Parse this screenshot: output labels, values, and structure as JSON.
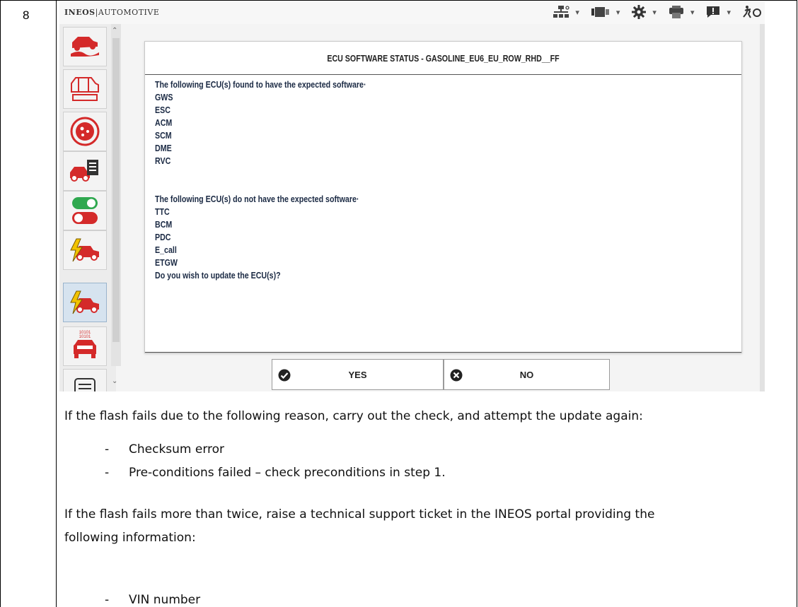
{
  "step_number": "8",
  "app": {
    "brand_bold": "INEOS",
    "brand_rest": "AUTOMOTIVE"
  },
  "toolbar": {
    "items": [
      {
        "icon": "network-icon",
        "caret": "▾"
      },
      {
        "icon": "connector-icon",
        "caret": "▾"
      },
      {
        "icon": "gear-icon",
        "caret": "▾"
      },
      {
        "icon": "printer-icon",
        "caret": "▾"
      },
      {
        "icon": "alert-icon",
        "caret": "▾"
      },
      {
        "icon": "exit-icon",
        "caret": ""
      }
    ]
  },
  "sidebar": {
    "items": [
      {
        "icon": "off-road-vehicle-icon",
        "active": false
      },
      {
        "icon": "vehicle-diagram-icon",
        "active": false
      },
      {
        "icon": "diagnostic-globe-icon",
        "active": false
      },
      {
        "icon": "vehicle-checklist-icon",
        "active": false
      },
      {
        "icon": "toggle-switches-icon",
        "active": false
      },
      {
        "icon": "vehicle-electric-icon",
        "active": false
      },
      {
        "icon": "vehicle-flash-icon",
        "active": true
      },
      {
        "icon": "binary-vehicle-icon",
        "active": false,
        "label": "10101\n10101"
      },
      {
        "icon": "document-icon",
        "active": false
      }
    ]
  },
  "dialog": {
    "title": "ECU SOFTWARE STATUS - GASOLINE_EU6_EU_ROW_RHD__FF",
    "found_heading": "The following ECU(s) found to have the expected software·",
    "found_ecus": [
      "GWS",
      "ESC",
      "ACM",
      "SCM",
      "DME",
      "RVC"
    ],
    "missing_heading": "The following ECU(s) do not have the expected software·",
    "missing_ecus": [
      "TTC",
      "BCM",
      "PDC",
      "E_call",
      "ETGW"
    ],
    "question": "Do you wish to update the ECU(s)?",
    "yes_label": "YES",
    "no_label": "NO"
  },
  "instructions": {
    "para1": "If the flash fails due to the following reason, carry out the check, and attempt the update again:",
    "list1": [
      "Checksum error",
      "Pre-conditions failed – check preconditions in step 1."
    ],
    "para2_line1": "If the flash fails more than twice, raise a technical support ticket in the INEOS portal providing the",
    "para2_line2": "following information:",
    "list2": [
      "VIN number"
    ],
    "bullet": "-"
  },
  "colors": {
    "icon_red": "#d42a2a",
    "toggle_green": "#2fa84f",
    "yellow_bolt": "#f2c300",
    "body_text": "#1b2a44"
  }
}
